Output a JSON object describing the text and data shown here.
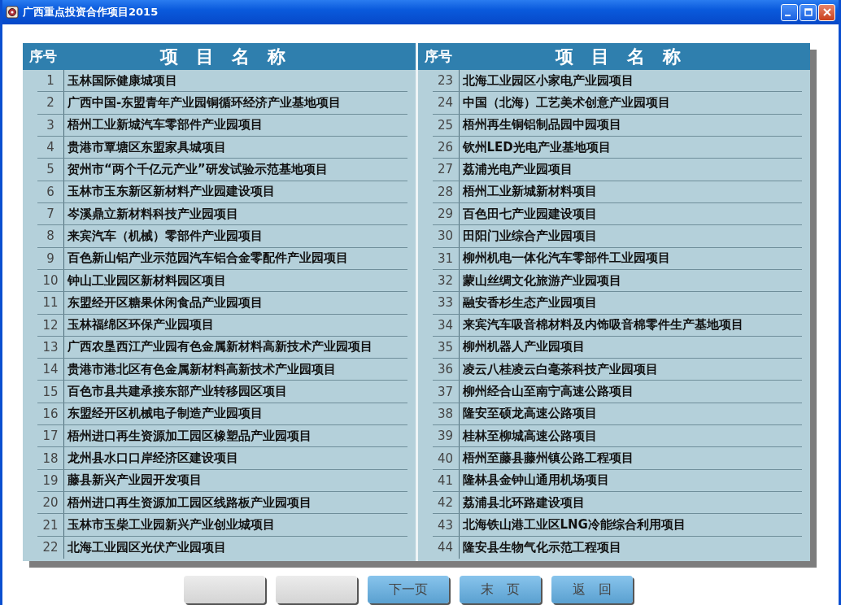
{
  "window": {
    "title": "广西重点投资合作项目2015"
  },
  "table": {
    "halves": [
      {
        "header": {
          "number": "序号",
          "name": "项　目　名　称"
        },
        "rows": [
          {
            "number": "1",
            "name": "玉林国际健康城项目"
          },
          {
            "number": "2",
            "name": "广西中国-东盟青年产业园铜循环经济产业基地项目"
          },
          {
            "number": "3",
            "name": "梧州工业新城汽车零部件产业园项目"
          },
          {
            "number": "4",
            "name": "贵港市覃塘区东盟家具城项目"
          },
          {
            "number": "5",
            "name": "贺州市“两个千亿元产业”研发试验示范基地项目"
          },
          {
            "number": "6",
            "name": "玉林市玉东新区新材料产业园建设项目"
          },
          {
            "number": "7",
            "name": "岑溪鼎立新材料科技产业园项目"
          },
          {
            "number": "8",
            "name": "来宾汽车（机械）零部件产业园项目"
          },
          {
            "number": "9",
            "name": "百色新山铝产业示范园汽车铝合金零配件产业园项目"
          },
          {
            "number": "10",
            "name": "钟山工业园区新材料园区项目"
          },
          {
            "number": "11",
            "name": "东盟经开区糖果休闲食品产业园项目"
          },
          {
            "number": "12",
            "name": "玉林福绵区环保产业园项目"
          },
          {
            "number": "13",
            "name": "广西农垦西江产业园有色金属新材料高新技术产业园项目"
          },
          {
            "number": "14",
            "name": "贵港市港北区有色金属新材料高新技术产业园项目"
          },
          {
            "number": "15",
            "name": "百色市县共建承接东部产业转移园区项目"
          },
          {
            "number": "16",
            "name": "东盟经开区机械电子制造产业园项目"
          },
          {
            "number": "17",
            "name": "梧州进口再生资源加工园区橡塑品产业园项目"
          },
          {
            "number": "18",
            "name": "龙州县水口口岸经济区建设项目"
          },
          {
            "number": "19",
            "name": "藤县新兴产业园开发项目"
          },
          {
            "number": "20",
            "name": "梧州进口再生资源加工园区线路板产业园项目"
          },
          {
            "number": "21",
            "name": "玉林市玉柴工业园新兴产业创业城项目"
          },
          {
            "number": "22",
            "name": "北海工业园区光伏产业园项目"
          }
        ]
      },
      {
        "header": {
          "number": "序号",
          "name": "项　目　名　称"
        },
        "rows": [
          {
            "number": "23",
            "name": "北海工业园区小家电产业园项目"
          },
          {
            "number": "24",
            "name": "中国（北海）工艺美术创意产业园项目"
          },
          {
            "number": "25",
            "name": "梧州再生铜铝制品园中园项目"
          },
          {
            "number": "26",
            "name": "钦州LED光电产业基地项目"
          },
          {
            "number": "27",
            "name": "荔浦光电产业园项目"
          },
          {
            "number": "28",
            "name": "梧州工业新城新材料项目"
          },
          {
            "number": "29",
            "name": "百色田七产业园建设项目"
          },
          {
            "number": "30",
            "name": "田阳门业综合产业园项目"
          },
          {
            "number": "31",
            "name": "柳州机电一体化汽车零部件工业园项目"
          },
          {
            "number": "32",
            "name": "蒙山丝绸文化旅游产业园项目"
          },
          {
            "number": "33",
            "name": "融安香杉生态产业园项目"
          },
          {
            "number": "34",
            "name": "来宾汽车吸音棉材料及内饰吸音棉零件生产基地项目"
          },
          {
            "number": "35",
            "name": "柳州机器人产业园项目"
          },
          {
            "number": "36",
            "name": "凌云八桂凌云白毫茶科技产业园项目"
          },
          {
            "number": "37",
            "name": "柳州经合山至南宁高速公路项目"
          },
          {
            "number": "38",
            "name": "隆安至硕龙高速公路项目"
          },
          {
            "number": "39",
            "name": "桂林至柳城高速公路项目"
          },
          {
            "number": "40",
            "name": "梧州至藤县藤州镇公路工程项目"
          },
          {
            "number": "41",
            "name": "隆林县金钟山通用机场项目"
          },
          {
            "number": "42",
            "name": "荔浦县北环路建设项目"
          },
          {
            "number": "43",
            "name": "北海铁山港工业区LNG冷能综合利用项目"
          },
          {
            "number": "44",
            "name": "隆安县生物气化示范工程项目"
          }
        ]
      }
    ]
  },
  "buttons": [
    {
      "kind": "blank"
    },
    {
      "kind": "blank"
    },
    {
      "kind": "nav",
      "label": "下一页"
    },
    {
      "kind": "nav",
      "label": "末　页"
    },
    {
      "kind": "nav",
      "label": "返　回"
    }
  ]
}
